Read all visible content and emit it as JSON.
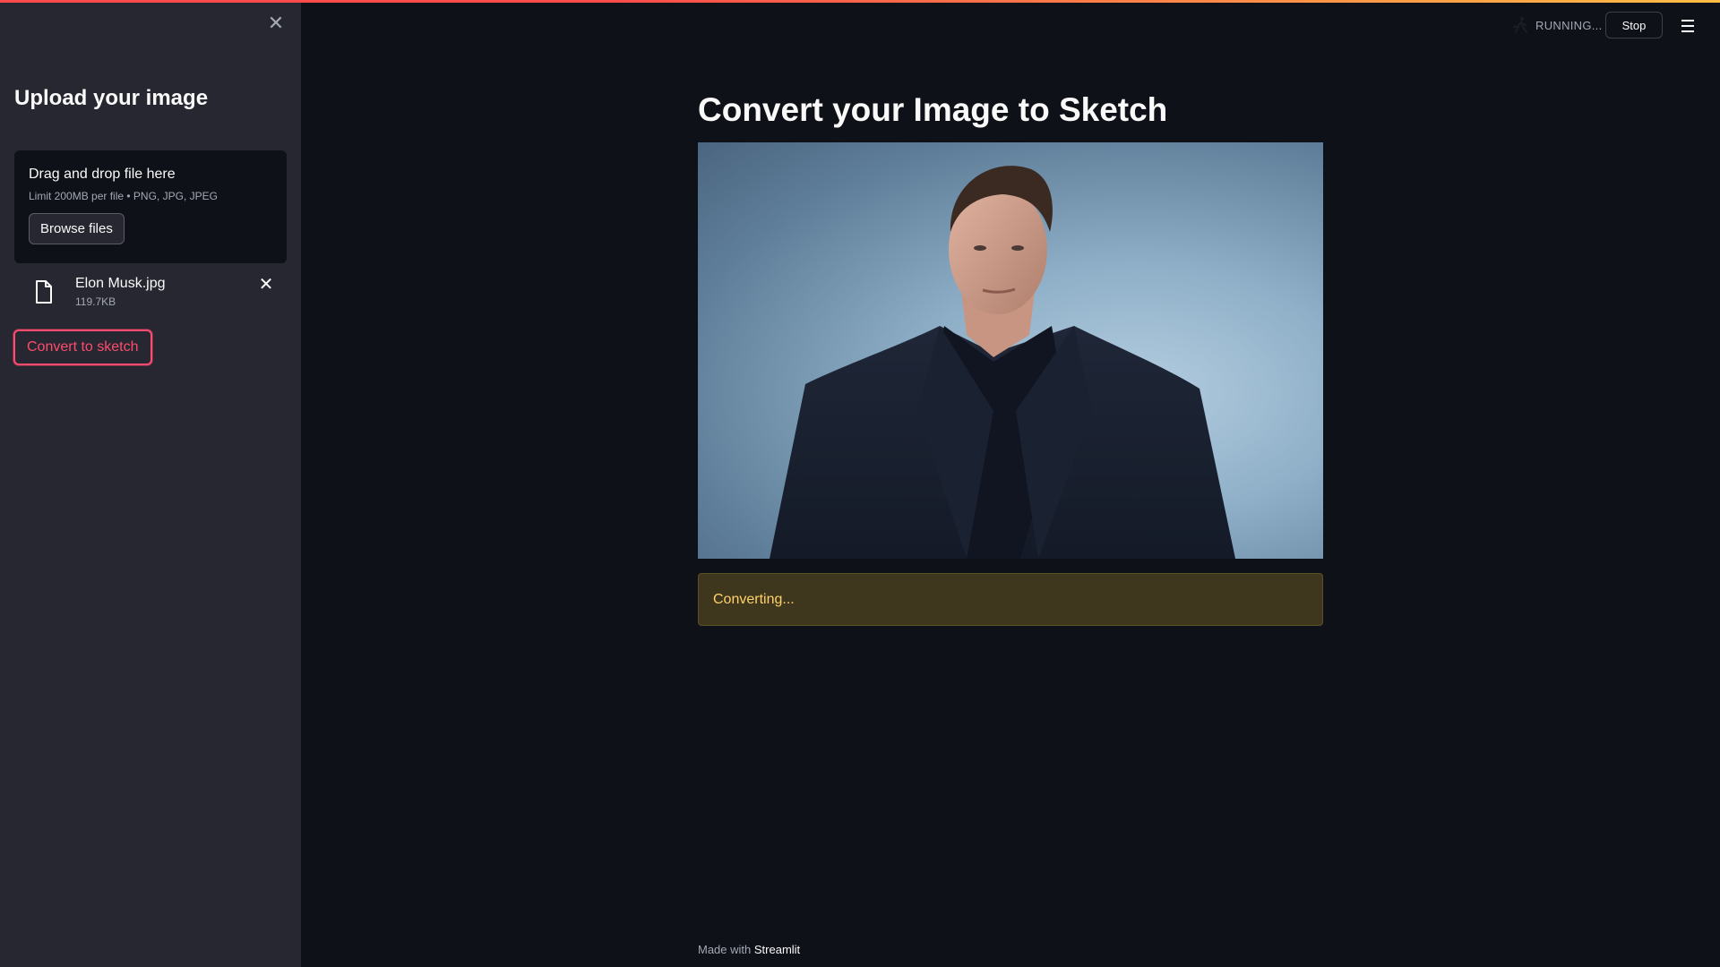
{
  "sidebar": {
    "title": "Upload your image",
    "uploader": {
      "drag_text": "Drag and drop file here",
      "limit_text": "Limit 200MB per file • PNG, JPG, JPEG",
      "browse_label": "Browse files"
    },
    "file": {
      "name": "Elon Musk.jpg",
      "size": "119.7KB"
    },
    "convert_label": "Convert to sketch"
  },
  "header": {
    "status": "RUNNING...",
    "stop_label": "Stop"
  },
  "main": {
    "title": "Convert your Image to Sketch",
    "alert": "Converting...",
    "footer_prefix": "Made with",
    "footer_brand": "Streamlit"
  },
  "colors": {
    "accent": "#ff4b6e",
    "sidebar_bg": "#262730",
    "main_bg": "#0e1117",
    "warning_bg": "#3e371d",
    "warning_text": "#ffd16a"
  }
}
